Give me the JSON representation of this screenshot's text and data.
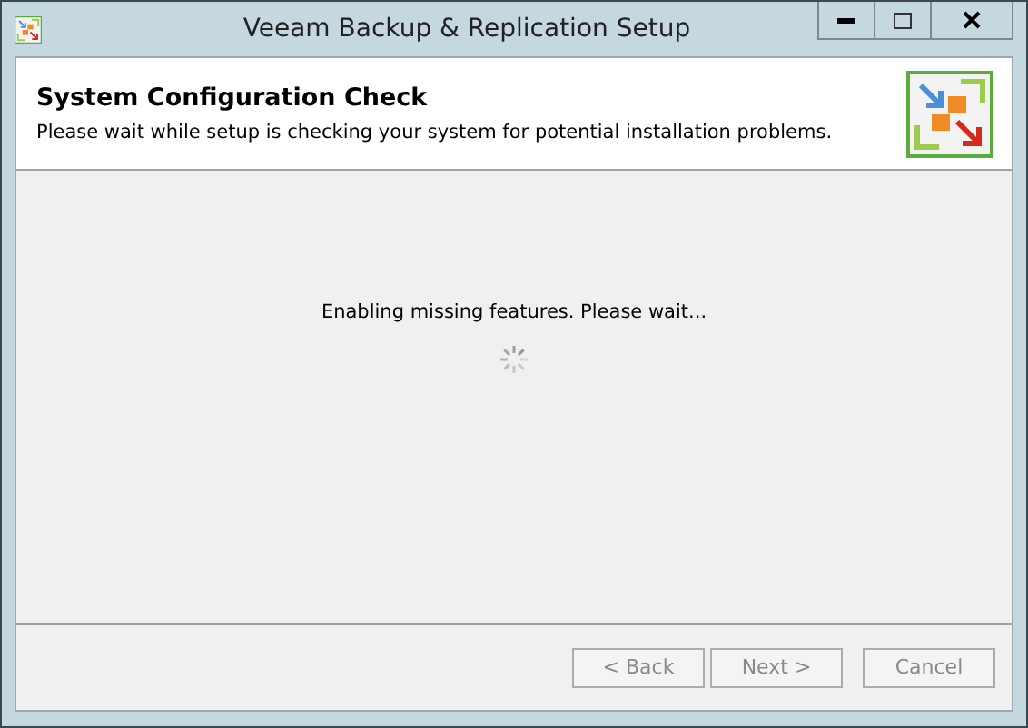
{
  "window": {
    "title": "Veeam Backup & Replication Setup"
  },
  "header": {
    "title": "System Configuration Check",
    "subtitle": "Please wait while setup is checking your system for potential installation problems."
  },
  "status": {
    "message": "Enabling missing features. Please wait..."
  },
  "buttons": [
    {
      "label": "< Back",
      "disabled": true
    },
    {
      "label": "Next >",
      "disabled": true
    },
    {
      "label": "Cancel",
      "disabled": true
    }
  ]
}
